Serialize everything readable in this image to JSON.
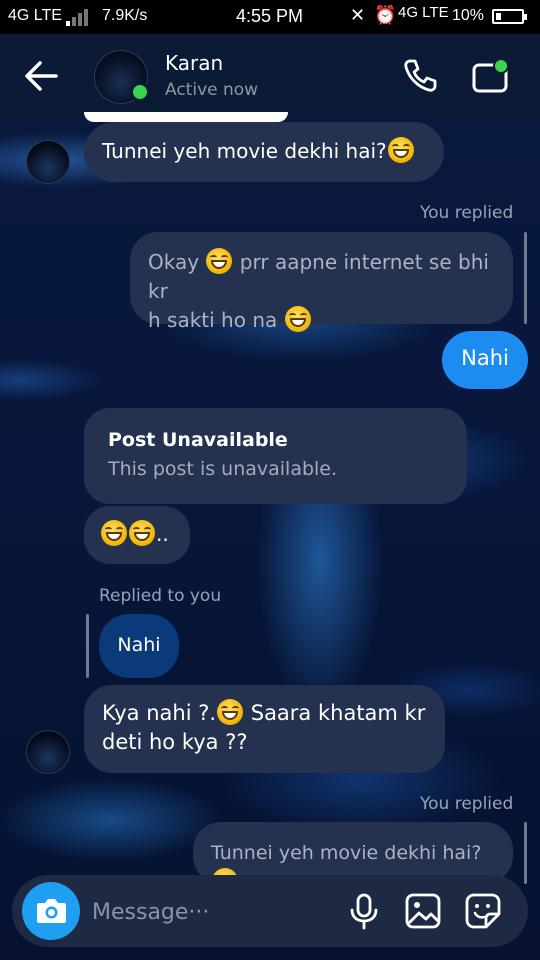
{
  "status_bar": {
    "network_left": "4G LTE",
    "speed": "7.9K/s",
    "time": "4:55 PM",
    "network_right": "4G LTE",
    "battery": "10%"
  },
  "header": {
    "contact_name": "Karan",
    "contact_status": "Active now"
  },
  "messages": [
    {
      "kind": "received",
      "text": "Tunnei yeh movie dekhi hai?"
    },
    {
      "kind": "reply_label",
      "text": "You replied"
    },
    {
      "kind": "replied_quote",
      "text_1": "Okay",
      "text_2": "prr aapne internet se bhi kr",
      "text_3": "h sakti ho na"
    },
    {
      "kind": "sent",
      "text": "Nahi"
    },
    {
      "kind": "post_card",
      "title": "Post Unavailable",
      "subtitle": "This post is unavailable."
    },
    {
      "kind": "received_emoji",
      "suffix": ".."
    },
    {
      "kind": "reply_label",
      "text": "Replied to you"
    },
    {
      "kind": "quoted_sent",
      "text": "Nahi"
    },
    {
      "kind": "received",
      "text_1": "Kya nahi ?.",
      "text_2": "Saara khatam kr",
      "text_3": "deti ho kya ??"
    },
    {
      "kind": "reply_label",
      "text": "You replied"
    },
    {
      "kind": "replied_quote",
      "text": "Tunnei yeh movie dekhi hai?"
    }
  ],
  "composer": {
    "placeholder": "Message···"
  },
  "icons": [
    "back-arrow-icon",
    "phone-icon",
    "video-camera-icon",
    "camera-icon",
    "microphone-icon",
    "gallery-icon",
    "sticker-icon",
    "grinning-emoji-icon"
  ],
  "colors": {
    "sent_bubble": "#1d8cf0",
    "received_bubble": "#25324f",
    "header": "#0b1a35",
    "online": "#3bd34b"
  }
}
